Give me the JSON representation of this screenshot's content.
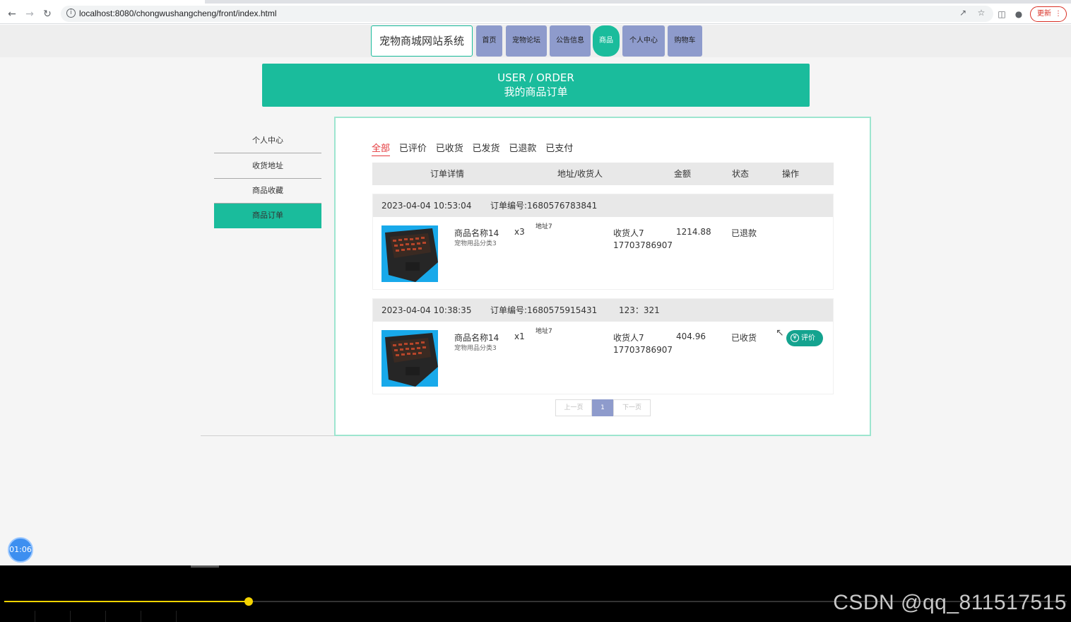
{
  "browser": {
    "url": "localhost:8080/chongwushangcheng/front/index.html",
    "update_label": "更新"
  },
  "site": {
    "title": "宠物商城网站系统",
    "nav": [
      "首页",
      "宠物论坛",
      "公告信息",
      "商品",
      "个人中心",
      "购物车"
    ],
    "active_nav": "商品"
  },
  "banner": {
    "en": "USER / ORDER",
    "cn": "我的商品订单"
  },
  "sidebar": {
    "items": [
      "个人中心",
      "收货地址",
      "商品收藏",
      "商品订单"
    ],
    "active": "商品订单"
  },
  "orders_panel": {
    "tabs": [
      "全部",
      "已评价",
      "已收货",
      "已发货",
      "已退款",
      "已支付"
    ],
    "active_tab": "全部",
    "columns": [
      "订单详情",
      "地址/收货人",
      "金额",
      "状态",
      "操作"
    ],
    "orders": [
      {
        "time": "2023-04-04 10:53:04",
        "order_no": "订单编号:1680576783841",
        "remark": "",
        "product_name": "商品名称14",
        "product_category": "宠物用品分类3",
        "qty": "x3",
        "address": "地址7",
        "receiver": "收货人7",
        "phone": "17703786907",
        "amount": "1214.88",
        "status": "已退款",
        "action": ""
      },
      {
        "time": "2023-04-04 10:38:35",
        "order_no": "订单编号:1680575915431",
        "remark": "123：321",
        "product_name": "商品名称14",
        "product_category": "宠物用品分类3",
        "qty": "x1",
        "address": "地址7",
        "receiver": "收货人7",
        "phone": "17703786907",
        "amount": "404.96",
        "status": "已收货",
        "action": "评价"
      }
    ],
    "pager": {
      "prev": "上一页",
      "current": "1",
      "next": "下一页"
    }
  },
  "overlay": {
    "timer": "01:06",
    "watermark": "CSDN @qq_811517515",
    "playback_progress": 0.23
  },
  "colors": {
    "accent": "#1abc9c",
    "nav": "#8e9bcc",
    "active_tab": "#e4393c",
    "progress": "#f5d400"
  }
}
